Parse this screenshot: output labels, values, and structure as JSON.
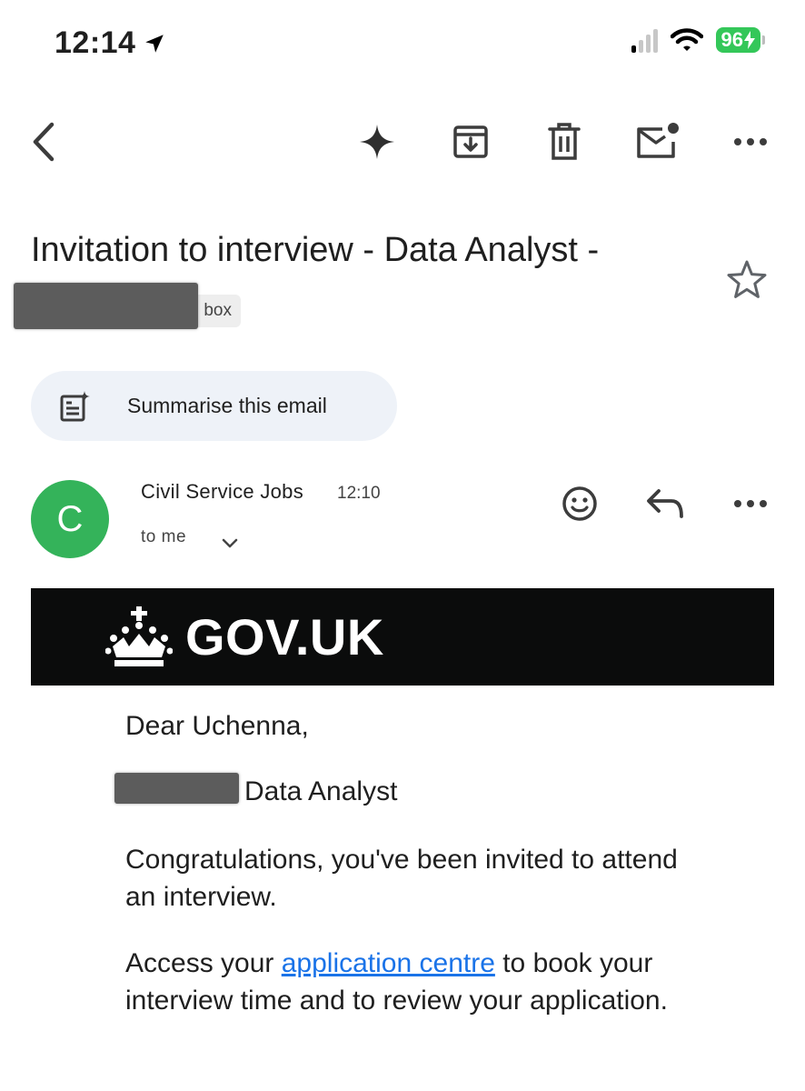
{
  "status_bar": {
    "time": "12:14",
    "battery": "96"
  },
  "toolbar": {
    "icons": [
      "back-icon",
      "gemini-sparkle-icon",
      "archive-icon",
      "trash-icon",
      "mark-unread-icon",
      "more-icon"
    ]
  },
  "email": {
    "subject": "Invitation to interview - Data Analyst -",
    "label_chip": "box",
    "summarise_label": "Summarise this email",
    "sender": {
      "initial": "C",
      "name": "Civil Service Jobs",
      "time": "12:10",
      "recipient": "to me"
    },
    "banner_text": "GOV.UK",
    "body": {
      "greeting": "Dear Uchenna,",
      "role": "Data Analyst",
      "congrats": "Congratulations, you've been invited to attend an interview.",
      "access_prefix": "Access your ",
      "access_link": "application centre",
      "access_suffix": " to book your interview time and to review your application."
    }
  },
  "colors": {
    "avatar": "#34b35a",
    "battery": "#34c759",
    "link": "#1a73e8",
    "summarise_bg": "#eef2f8",
    "banner_bg": "#0b0c0c"
  }
}
